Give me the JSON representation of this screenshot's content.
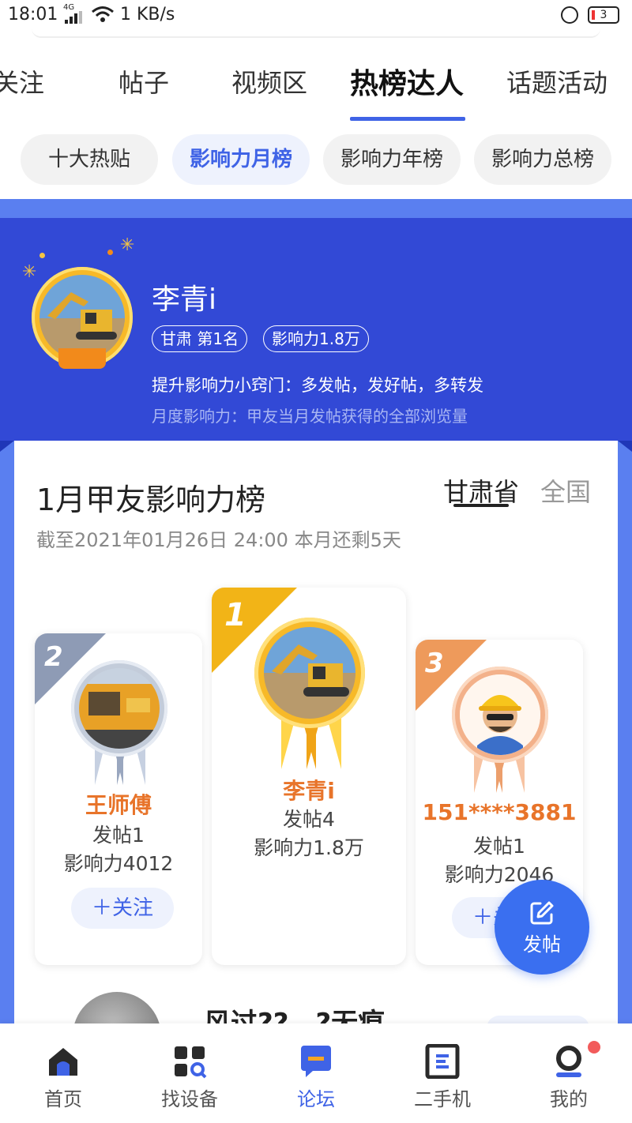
{
  "status": {
    "time": "18:01",
    "network": "4G",
    "speed": "1 KB/s",
    "battery": "3"
  },
  "tabs": [
    {
      "label": "关注"
    },
    {
      "label": "帖子"
    },
    {
      "label": "视频区"
    },
    {
      "label": "热榜达人",
      "active": true
    },
    {
      "label": "话题活动"
    }
  ],
  "chips": [
    {
      "label": "十大热贴"
    },
    {
      "label": "影响力月榜",
      "active": true
    },
    {
      "label": "影响力年榜"
    },
    {
      "label": "影响力总榜"
    }
  ],
  "hero": {
    "name": "李青i",
    "badge_rank": "甘肃  第1名",
    "badge_influence": "影响力1.8万",
    "tip": "提升影响力小窍门：多发帖，发好帖，多转发",
    "definition": "月度影响力：甲友当月发帖获得的全部浏览量"
  },
  "board": {
    "title": "1月甲友影响力榜",
    "region_tabs": [
      {
        "label": "甘肃省",
        "active": true
      },
      {
        "label": "全国"
      }
    ],
    "subtitle": "截至2021年01月26日 24:00 本月还剩5天"
  },
  "podium": [
    {
      "rank": "2",
      "name": "王师傅",
      "posts": "发帖1",
      "influence": "影响力4012",
      "follow": "＋关注"
    },
    {
      "rank": "1",
      "name": "李青i",
      "posts": "发帖4",
      "influence": "影响力1.8万"
    },
    {
      "rank": "3",
      "name": "151****3881",
      "posts": "发帖1",
      "influence": "影响力2046",
      "follow": "＋关注"
    }
  ],
  "next_row": {
    "title": "风过??　?无痕"
  },
  "fab": {
    "label": "发帖"
  },
  "bottom_nav": [
    {
      "label": "首页",
      "icon": "home-icon"
    },
    {
      "label": "找设备",
      "icon": "qr-search-icon"
    },
    {
      "label": "论坛",
      "icon": "forum-icon",
      "active": true
    },
    {
      "label": "二手机",
      "icon": "used-machine-icon"
    },
    {
      "label": "我的",
      "icon": "profile-icon"
    }
  ],
  "colors": {
    "accent": "#3f63e6",
    "hero_bg": "#3249d6",
    "gold": "#f7b928",
    "orange_name": "#e8742a"
  }
}
